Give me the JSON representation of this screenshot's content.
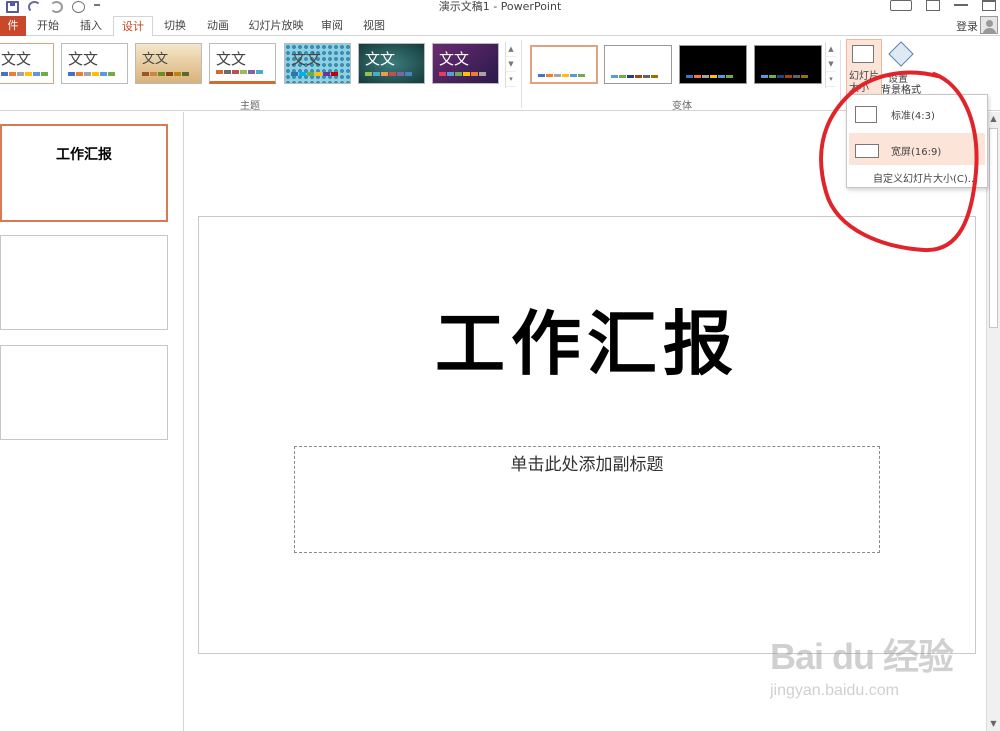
{
  "window": {
    "title": "演示文稿1 - PowerPoint",
    "login": "登录"
  },
  "tabs": [
    {
      "label": "件"
    },
    {
      "label": "开始"
    },
    {
      "label": "插入"
    },
    {
      "label": "设计"
    },
    {
      "label": "切换"
    },
    {
      "label": "动画"
    },
    {
      "label": "幻灯片放映"
    },
    {
      "label": "审阅"
    },
    {
      "label": "视图"
    }
  ],
  "active_tab": "设计",
  "ribbon": {
    "themes": [
      {
        "label": "文文"
      },
      {
        "label": "文文"
      },
      {
        "label": "文文"
      },
      {
        "label": "文文"
      },
      {
        "label": "文文"
      },
      {
        "label": "文文"
      },
      {
        "label": "文文"
      }
    ],
    "themes_group_label": "主题",
    "variants_group_label": "变体",
    "slide_size_button": {
      "line1": "幻灯片",
      "line2": "大小"
    },
    "bg_format_button": {
      "line1": "设置"
    },
    "bg_format_label": "背景格式"
  },
  "slide_size_menu": {
    "standard": "标准(4:3)",
    "widescreen": "宽屏(16:9)",
    "custom": "自定义幻灯片大小(C)..."
  },
  "thumbnails": [
    {
      "title": "工作汇报"
    },
    {
      "title": ""
    },
    {
      "title": ""
    }
  ],
  "slide": {
    "title": "工作汇报",
    "subtitle_placeholder": "单击此处添加副标题"
  },
  "watermark": {
    "logo": "Bai du 经验",
    "url": "jingyan.baidu.com"
  },
  "colors": {
    "accent": "#c2451e",
    "file_tab": "#c9472a",
    "selection": "#fce4d8",
    "annotation": "#e0242b"
  }
}
